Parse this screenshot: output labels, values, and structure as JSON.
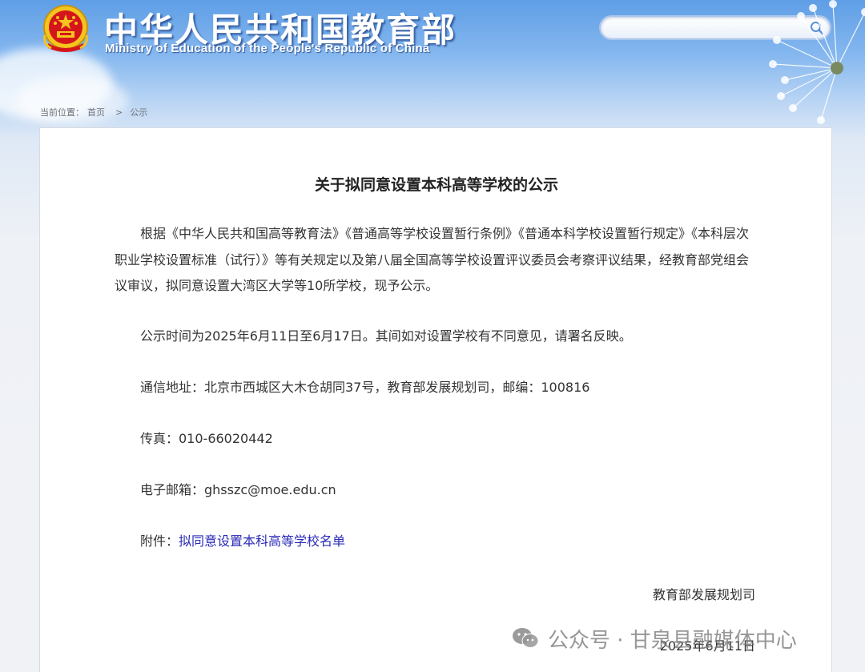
{
  "header": {
    "title_cn": "中华人民共和国教育部",
    "title_en": "Ministry of Education of the People's Republic of China",
    "search": {
      "placeholder": "",
      "value": ""
    }
  },
  "breadcrumb": {
    "prefix": "当前位置：",
    "items": [
      "首页",
      "公示"
    ],
    "separator": ">"
  },
  "article": {
    "title": "关于拟同意设置本科高等学校的公示",
    "paragraph1": "根据《中华人民共和国高等教育法》《普通高等学校设置暂行条例》《普通本科学校设置暂行规定》《本科层次职业学校设置标准（试行）》等有关规定以及第八届全国高等学校设置评议委员会考察评议结果，经教育部党组会议审议，拟同意设置大湾区大学等10所学校，现予公示。",
    "paragraph2": "公示时间为2025年6月11日至6月17日。其间如对设置学校有不同意见，请署名反映。",
    "address": "通信地址：北京市西城区大木仓胡同37号，教育部发展规划司，邮编：100816",
    "fax": "传真：010-66020442",
    "email": "电子邮箱：ghsszc@moe.edu.cn",
    "attachment_label": "附件：",
    "attachment_link": "拟同意设置本科高等学校名单",
    "signature": "教育部发展规划司",
    "date": "2025年6月11日"
  },
  "watermark": {
    "text": "公众号 · 甘泉县融媒体中心",
    "icon": "wechat-icon"
  },
  "colors": {
    "link": "#2a2ab8",
    "header_sky": "#5f9ee6",
    "emblem_red": "#d4161b",
    "emblem_gold": "#f4c41f"
  }
}
